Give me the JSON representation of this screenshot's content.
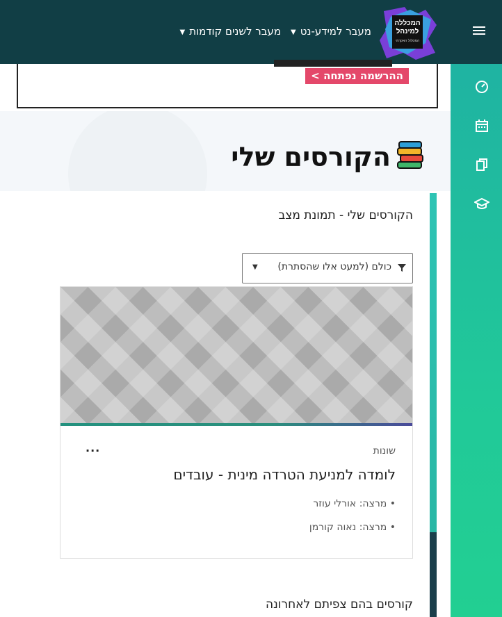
{
  "topbar": {
    "logo_lines": [
      "המכללה",
      "למינהל",
      "המסלול האקדמי"
    ],
    "nav": [
      {
        "label": "מעבר למידע-נט"
      },
      {
        "label": "מעבר לשנים קודמות"
      }
    ],
    "menu_icon": "hamburger-icon"
  },
  "sidebar": {
    "icons": [
      "dashboard-icon",
      "calendar-icon",
      "files-icon",
      "graduation-cap-icon"
    ]
  },
  "notice": {
    "badge": "ההרשמה נפתחה >"
  },
  "hero": {
    "title": "הקורסים שלי",
    "icon": "books-icon"
  },
  "overview": {
    "title": "הקורסים שלי - תמונת מצב",
    "filter_label": "כולם (למעט אלו שהסתרת)",
    "filter_icon": "filter-icon"
  },
  "course": {
    "category": "שונות",
    "title": "לומדה למניעת הטרדה מינית - עובדים",
    "menu": "...",
    "lecturers": [
      "• מרצה: אורלי עוזר",
      "• מרצה: נאוה קורמן"
    ]
  },
  "recent": {
    "title": "קורסים בהם צפיתם לאחרונה"
  },
  "colors": {
    "topbar": "#113e45",
    "sidebar": "#21c999",
    "badge": "#e4486a",
    "accent": "#2b8f7d"
  }
}
